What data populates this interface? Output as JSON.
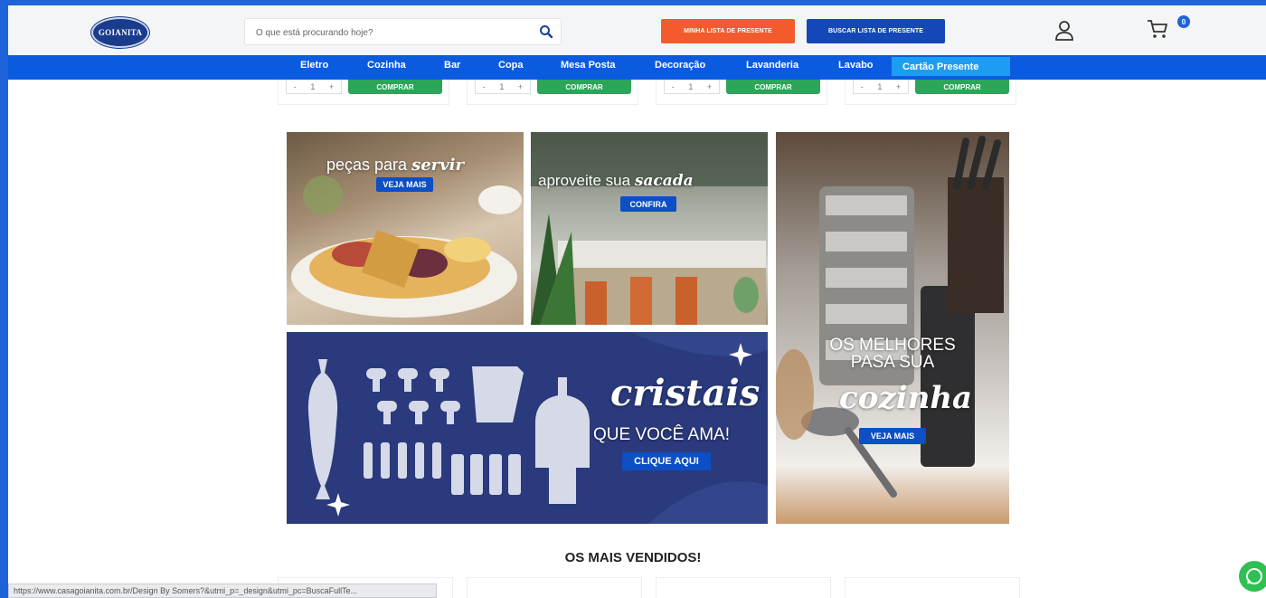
{
  "header": {
    "logo_text": "GOIANITA",
    "search": {
      "placeholder": "O que está procurando hoje?"
    },
    "buttons": {
      "my_list": "MINHA LISTA DE PRESENTE",
      "search_list": "BUSCAR LISTA DE PRESENTE"
    },
    "cart_count": "0"
  },
  "nav": {
    "items": [
      "Eletro",
      "Cozinha",
      "Bar",
      "Copa",
      "Mesa Posta",
      "Decoração",
      "Lavanderia",
      "Lavabo",
      "Cartão Presente"
    ]
  },
  "products_row": {
    "stepper": {
      "minus": "-",
      "value": "1",
      "plus": "+"
    },
    "buy_label": "COMPRAR"
  },
  "banners": {
    "servir": {
      "title_prefix": "peças para",
      "title_script": "servir",
      "button": "VEJA MAIS"
    },
    "sacada": {
      "title_prefix": "aproveite sua",
      "title_script": "sacada",
      "button": "CONFIRA"
    },
    "cozinha": {
      "title_line1": "OS MELHORES",
      "title_line2": "PASA SUA",
      "title_script": "cozinha",
      "button": "VEJA MAIS"
    },
    "cristais": {
      "title_script": "cristais",
      "subtitle": "QUE VOCÊ AMA!",
      "button": "CLIQUE AQUI"
    }
  },
  "bestsellers_title": "OS MAIS VENDIDOS!",
  "status_url": "https://www.casagoianita.com.br/Design By Somers?&utmi_p=_design&utmi_pc=BuscaFullTe...",
  "colors": {
    "nav_blue": "#0b5be0",
    "orange": "#f35b2d",
    "dark_blue": "#1448b8",
    "green": "#2ca558",
    "banner_navy": "#2a3a7c"
  }
}
